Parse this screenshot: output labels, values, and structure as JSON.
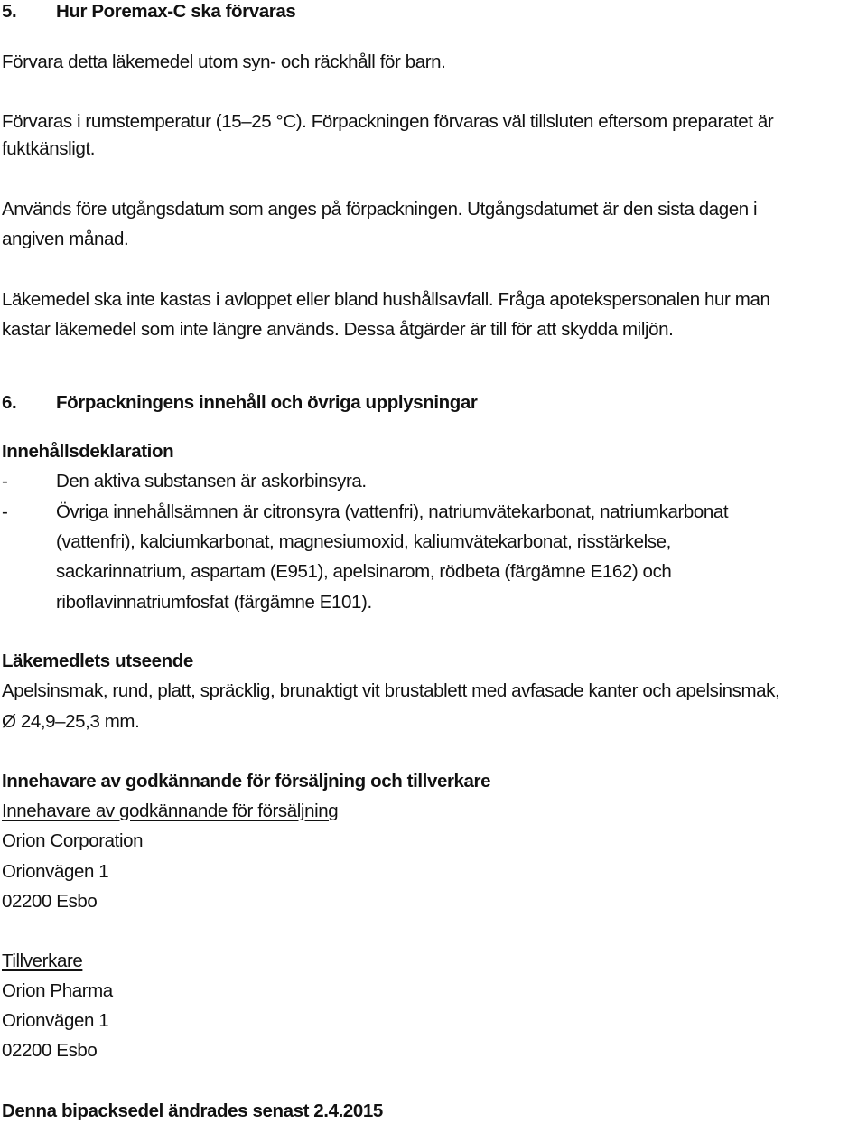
{
  "section5": {
    "number": "5.",
    "title": "Hur Poremax-C ska förvaras",
    "paragraphs": [
      "Förvara detta läkemedel utom syn- och räckhåll för barn.",
      [
        "Förvaras i rumstemperatur (15–25 °C). Förpackningen förvaras väl tillsluten eftersom preparatet är",
        "fuktkänsligt."
      ],
      [
        "Används före utgångsdatum som anges på förpackningen. Utgångsdatumet är den sista dagen i",
        "angiven månad."
      ],
      [
        "Läkemedel ska inte kastas i avloppet eller bland hushållsavfall. Fråga apotekspersonalen hur man",
        "kastar läkemedel som inte längre används. Dessa åtgärder är till för att skydda miljön."
      ]
    ]
  },
  "section6": {
    "number": "6.",
    "title": "Förpackningens innehåll och övriga upplysningar",
    "declaration": {
      "heading": "Innehållsdeklaration",
      "bullet": "-",
      "items": [
        [
          "Den aktiva substansen är askorbinsyra."
        ],
        [
          "Övriga innehållsämnen är citronsyra (vattenfri), natriumvätekarbonat, natriumkarbonat",
          "(vattenfri), kalciumkarbonat, magnesiumoxid, kaliumvätekarbonat, risstärkelse,",
          "sackarinnatrium, aspartam (E951), apelsinarom, rödbeta (färgämne E162) och",
          "riboflavinnatriumfosfat (färgämne E101)."
        ]
      ]
    },
    "appearance": {
      "heading": "Läkemedlets utseende",
      "lines": [
        "Apelsinsmak, rund, platt, spräcklig, brunaktigt vit brustablett med avfasade kanter och apelsinsmak,",
        "Ø 24,9–25,3  mm."
      ]
    },
    "holder": {
      "heading": "Innehavare av godkännande för försäljning och tillverkare",
      "mah_label": "Innehavare av godkännande för försäljning",
      "mah_lines": [
        "Orion Corporation",
        "Orionvägen 1",
        "02200  Esbo"
      ],
      "manufacturer_label": "Tillverkare",
      "manufacturer_lines": [
        "Orion Pharma",
        "Orionvägen 1",
        "02200  Esbo"
      ]
    },
    "revision": "Denna bipacksedel ändrades senast 2.4.2015"
  }
}
